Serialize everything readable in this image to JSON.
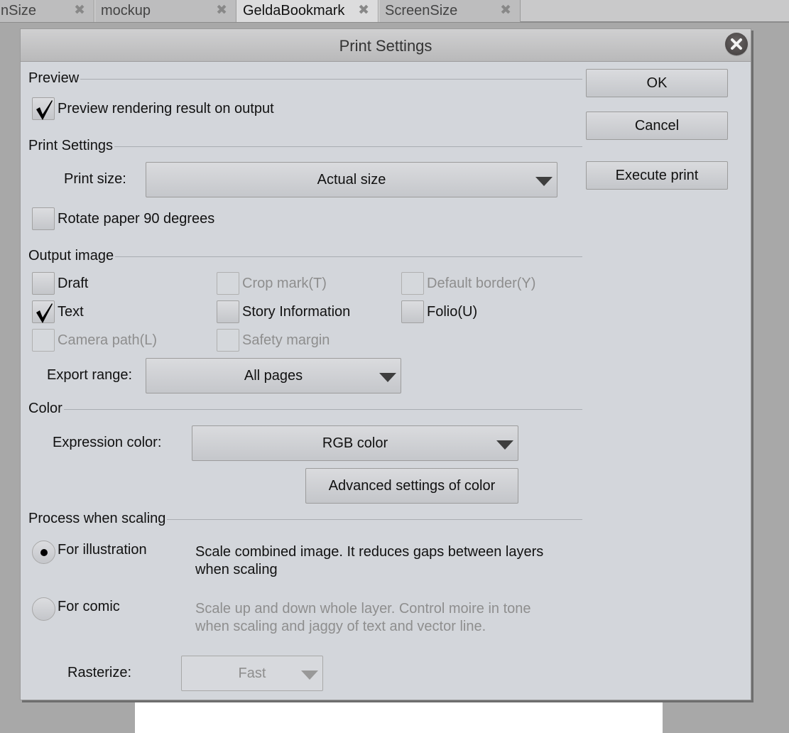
{
  "tabs": [
    {
      "label": "nSize",
      "active": false
    },
    {
      "label": "mockup",
      "active": false
    },
    {
      "label": "GeldaBookmark",
      "active": true
    },
    {
      "label": "ScreenSize",
      "active": false
    }
  ],
  "tab_close_glyph": "✖",
  "dialog": {
    "title": "Print Settings",
    "buttons": {
      "ok": "OK",
      "cancel": "Cancel",
      "execute": "Execute print"
    },
    "preview": {
      "title": "Preview",
      "preview_rendering": {
        "label": "Preview rendering result on output",
        "checked": true
      }
    },
    "print_settings": {
      "title": "Print Settings",
      "print_size_label": "Print size:",
      "print_size_value": "Actual size",
      "rotate": {
        "label": "Rotate paper 90 degrees",
        "checked": false
      }
    },
    "output_image": {
      "title": "Output image",
      "options": [
        {
          "label": "Draft",
          "checked": false,
          "enabled": true
        },
        {
          "label": "Crop mark(T)",
          "checked": false,
          "enabled": false
        },
        {
          "label": "Default border(Y)",
          "checked": false,
          "enabled": false
        },
        {
          "label": "Text",
          "checked": true,
          "enabled": true
        },
        {
          "label": "Story Information",
          "checked": false,
          "enabled": true
        },
        {
          "label": "Folio(U)",
          "checked": false,
          "enabled": true
        },
        {
          "label": "Camera path(L)",
          "checked": false,
          "enabled": false
        },
        {
          "label": "Safety margin",
          "checked": false,
          "enabled": false
        }
      ],
      "export_range_label": "Export range:",
      "export_range_value": "All pages"
    },
    "color": {
      "title": "Color",
      "expression_color_label": "Expression color:",
      "expression_color_value": "RGB color",
      "advanced_button": "Advanced settings of color"
    },
    "scaling": {
      "title": "Process when scaling",
      "options": [
        {
          "label": "For illustration",
          "selected": true,
          "description": "Scale combined image. It reduces gaps between layers when scaling",
          "enabled": true
        },
        {
          "label": "For comic",
          "selected": false,
          "description": "Scale up and down whole layer. Control moire in tone when scaling and jaggy of text and vector line.",
          "enabled": false
        }
      ],
      "rasterize_label": "Rasterize:",
      "rasterize_value": "Fast"
    }
  }
}
